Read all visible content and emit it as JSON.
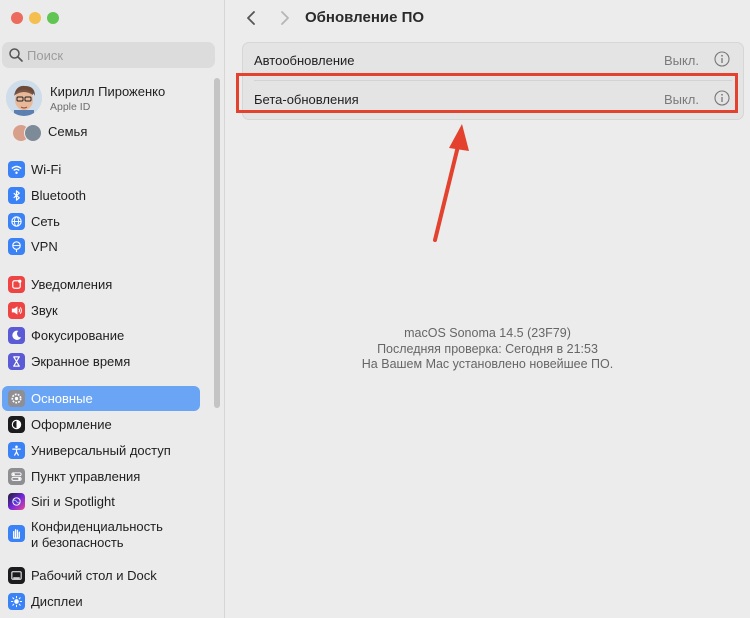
{
  "window": {
    "traffic_colors": [
      "#ec6a5e",
      "#f4bf4f",
      "#61c554"
    ]
  },
  "search": {
    "placeholder": "Поиск"
  },
  "account": {
    "name": "Кирилл Пироженко",
    "subtitle": "Apple ID"
  },
  "family": {
    "label": "Семья"
  },
  "sidebar": {
    "items": [
      {
        "label": "Wi-Fi",
        "icon": "wifi-icon",
        "color": "#3b82f6"
      },
      {
        "label": "Bluetooth",
        "icon": "bluetooth-icon",
        "color": "#3b82f6"
      },
      {
        "label": "Сеть",
        "icon": "globe-icon",
        "color": "#3b82f6"
      },
      {
        "label": "VPN",
        "icon": "vpn-globe-icon",
        "color": "#3b82f6"
      },
      {
        "label": "Уведомления",
        "icon": "bell-icon",
        "color": "#ef4444"
      },
      {
        "label": "Звук",
        "icon": "speaker-icon",
        "color": "#ef4444"
      },
      {
        "label": "Фокусирование",
        "icon": "moon-icon",
        "color": "#5b5bd6"
      },
      {
        "label": "Экранное время",
        "icon": "hourglass-icon",
        "color": "#5b5bd6"
      },
      {
        "label": "Основные",
        "icon": "gear-icon",
        "color": "#8e8e93",
        "selected": true
      },
      {
        "label": "Оформление",
        "icon": "appearance-icon",
        "color": "#1c1c1e"
      },
      {
        "label": "Универсальный доступ",
        "icon": "accessibility-icon",
        "color": "#3b82f6"
      },
      {
        "label": "Пункт управления",
        "icon": "control-center-icon",
        "color": "#8e8e93"
      },
      {
        "label": "Siri и Spotlight",
        "icon": "siri-icon",
        "color": "#a855f7"
      },
      {
        "label": "Конфиденциальность",
        "label2": "и безопасность",
        "icon": "hand-icon",
        "color": "#3b82f6"
      },
      {
        "label": "Рабочий стол и Dock",
        "icon": "dock-icon",
        "color": "#1c1c1e"
      },
      {
        "label": "Дисплеи",
        "icon": "sun-icon",
        "color": "#3b82f6"
      }
    ]
  },
  "main": {
    "title": "Обновление ПО",
    "rows": [
      {
        "label": "Автообновление",
        "value": "Выкл."
      },
      {
        "label": "Бета-обновления",
        "value": "Выкл."
      }
    ],
    "status": [
      "macOS Sonoma 14.5 (23F79)",
      "Последняя проверка: Сегодня в 21:53",
      "На Вашем Mac установлено новейшее ПО."
    ]
  },
  "annotation": {
    "highlight_color": "#e3432e"
  }
}
